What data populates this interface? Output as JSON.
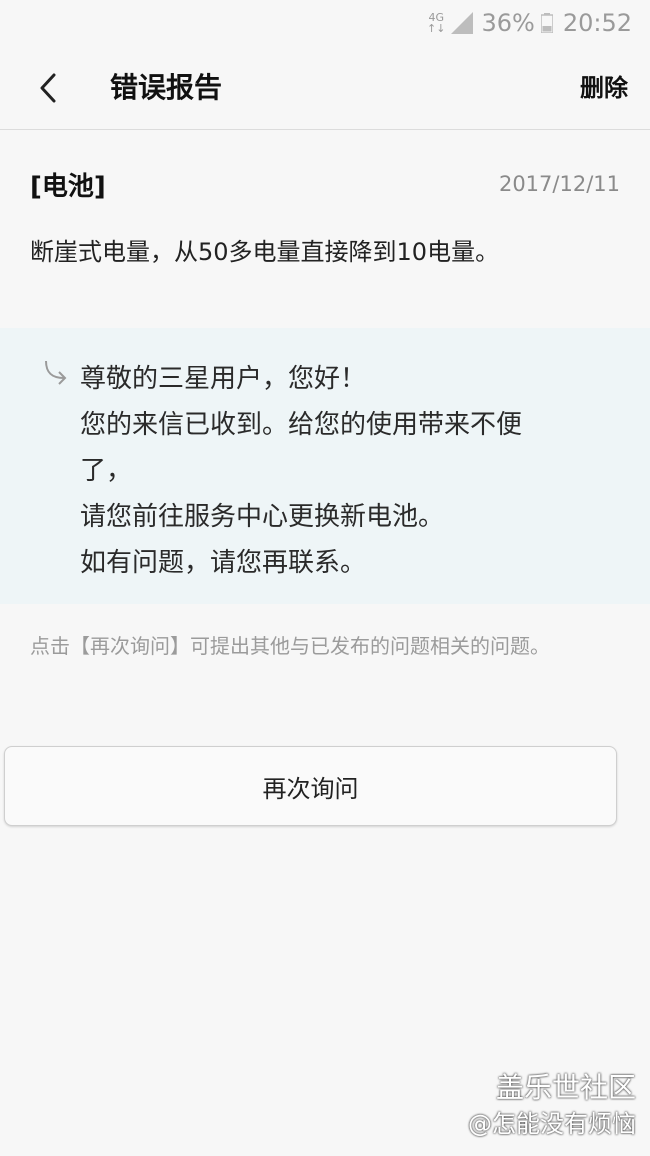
{
  "status_bar": {
    "network": "4G",
    "battery_percent": "36%",
    "time": "20:52",
    "icons": [
      "network-4g-icon",
      "signal-icon",
      "battery-icon"
    ]
  },
  "header": {
    "title": "错误报告",
    "delete_label": "删除",
    "back_icon": "chevron-left-icon"
  },
  "report": {
    "category": "[电池]",
    "date": "2017/12/11",
    "body": "断崖式电量，从50多电量直接降到10电量。"
  },
  "reply": {
    "icon": "reply-arrow-icon",
    "lines": [
      "尊敬的三星用户，您好！",
      "您的来信已收到。给您的使用带来不便",
      "了，",
      "请您前往服务中心更换新电池。",
      "如有问题，请您再联系。"
    ]
  },
  "hint": "点击【再次询问】可提出其他与已发布的问题相关的问题。",
  "ask_again_label": "再次询问",
  "watermark": {
    "line1": "盖乐世社区",
    "line2": "@怎能没有烦恼"
  },
  "colors": {
    "background": "#f7f7f7",
    "reply_background": "#eef5f7",
    "hint_text": "#9b9b9b"
  }
}
